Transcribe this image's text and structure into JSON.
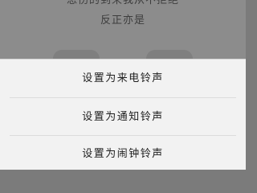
{
  "background": {
    "lyrics": [
      "悲伤的到来我从不拒绝",
      "反正亦是"
    ]
  },
  "sheet": {
    "items": [
      {
        "label": "设置为来电铃声"
      },
      {
        "label": "设置为通知铃声"
      },
      {
        "label": "设置为闹钟铃声"
      }
    ]
  },
  "colors": {
    "overlay": "#8c8c8c",
    "sheet_background": "#f2f2f2",
    "text": "#1e1e1e",
    "divider": "#dcdcdc"
  }
}
